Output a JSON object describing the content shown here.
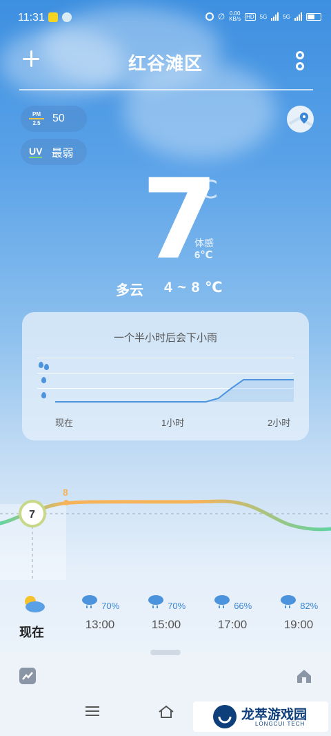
{
  "status_bar": {
    "time": "11:31",
    "netspeed_top": "0.00",
    "netspeed_bottom": "KB/s",
    "hd": "HD",
    "sig1": "5G",
    "sig2": "5G",
    "battery": "51"
  },
  "header": {
    "city": "红谷滩区"
  },
  "indicators": {
    "pm_top": "PM",
    "pm_bottom": "2.5",
    "pm_value": "50",
    "uv_label": "UV",
    "uv_value": "最弱"
  },
  "current": {
    "temp": "7",
    "unit": "℃",
    "feels_label": "体感",
    "feels_value": "6℃",
    "condition": "多云",
    "range": "4 ~ 8 ℃"
  },
  "rain_card": {
    "title": "一个半小时后会下小雨",
    "axis": [
      "现在",
      "1小时",
      "2小时"
    ],
    "precip_series": [
      0,
      0,
      0,
      0,
      0,
      0,
      0,
      0,
      0,
      0,
      0,
      0,
      0,
      0.08,
      0.3,
      0.5,
      0.5,
      0.5,
      0.5,
      0.5
    ]
  },
  "trend": {
    "current_temp": "7",
    "peak_label": "8"
  },
  "hourly": [
    {
      "label": "现在",
      "pct": "",
      "icon": "partly-cloudy-icon"
    },
    {
      "label": "13:00",
      "pct": "70%",
      "icon": "rain-icon"
    },
    {
      "label": "15:00",
      "pct": "70%",
      "icon": "rain-icon"
    },
    {
      "label": "17:00",
      "pct": "66%",
      "icon": "rain-icon"
    },
    {
      "label": "19:00",
      "pct": "82%",
      "icon": "rain-icon"
    }
  ],
  "watermark": {
    "name": "龙萃游戏园",
    "sub": "LONGCUI TECH"
  },
  "colors": {
    "accent": "#4c93de",
    "warm": "#f6b35a",
    "cool": "#5fd3a0"
  }
}
